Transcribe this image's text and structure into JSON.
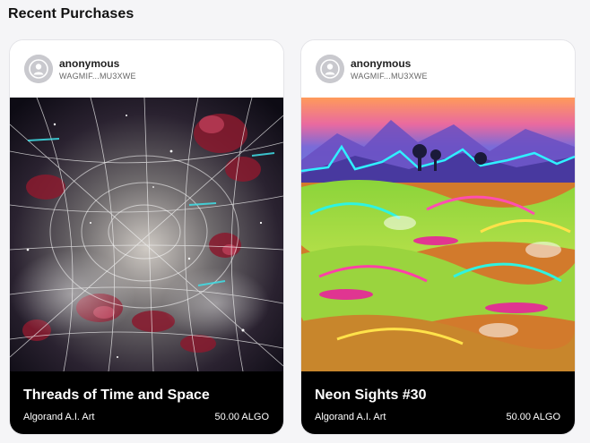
{
  "section": {
    "title": "Recent Purchases"
  },
  "cards": [
    {
      "user": {
        "name": "anonymous",
        "address": "WAGMIF...MU3XWE",
        "avatar_icon": "user-avatar-icon"
      },
      "title": "Threads of Time and Space",
      "collection": "Algorand A.I. Art",
      "price": "50.00 ALGO"
    },
    {
      "user": {
        "name": "anonymous",
        "address": "WAGMIF...MU3XWE",
        "avatar_icon": "user-avatar-icon"
      },
      "title": "Neon Sights #30",
      "collection": "Algorand A.I. Art",
      "price": "50.00 ALGO"
    }
  ],
  "colors": {
    "background": "#f5f5f7",
    "card": "#ffffff",
    "footer": "#000000",
    "avatar": "#c9c9ce"
  }
}
